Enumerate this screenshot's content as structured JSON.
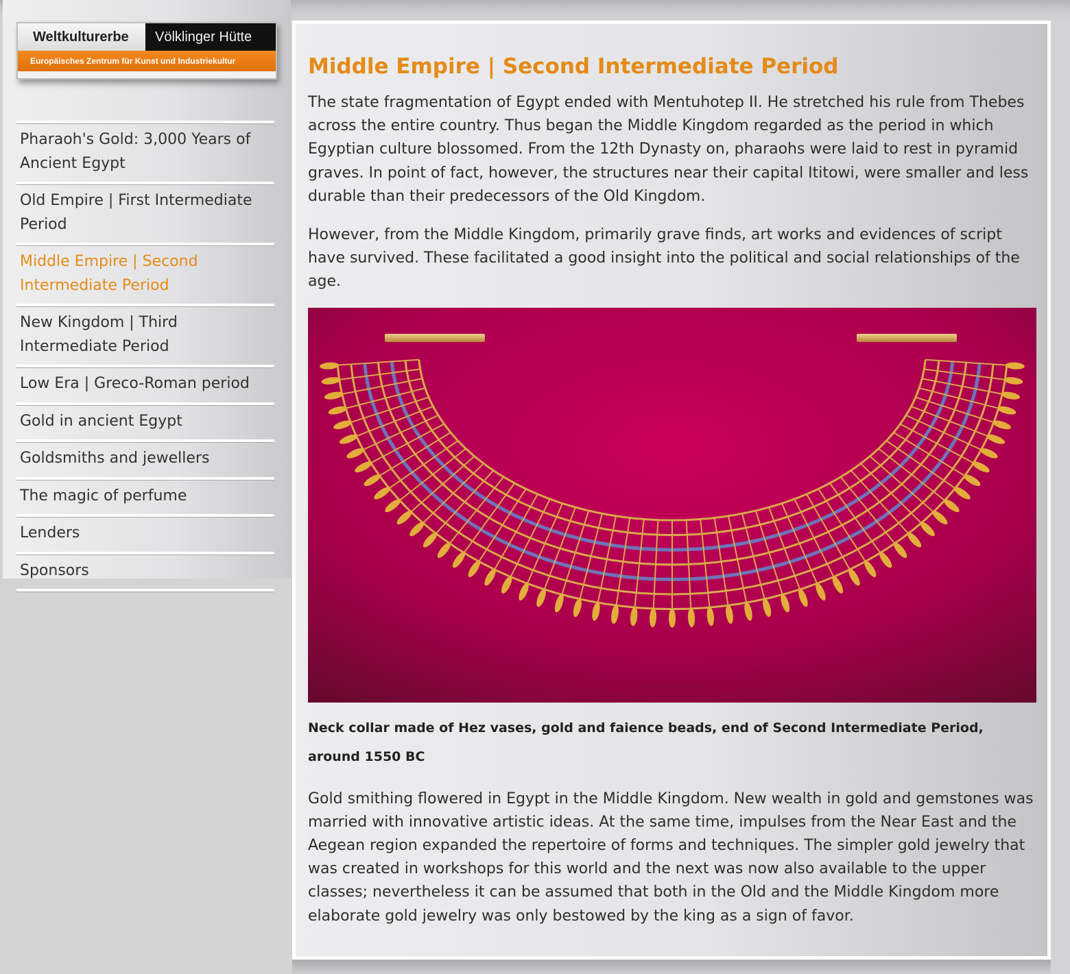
{
  "logo": {
    "left_text": "Weltkulturerbe",
    "right_text": "Völklinger Hütte",
    "subtitle": "Europäisches Zentrum für Kunst und Industriekultur"
  },
  "nav": {
    "items": [
      {
        "label": "Pharaoh's Gold: 3,000 Years of Ancient Egypt",
        "active": false
      },
      {
        "label": "Old Empire | First Intermediate Period",
        "active": false
      },
      {
        "label": "Middle Empire | Second Intermediate Period",
        "active": true
      },
      {
        "label": "New Kingdom | Third Intermediate Period",
        "active": false
      },
      {
        "label": "Low Era | Greco-Roman period",
        "active": false
      },
      {
        "label": "Gold in ancient Egypt",
        "active": false
      },
      {
        "label": "Goldsmiths and jewellers",
        "active": false
      },
      {
        "label": "The magic of perfume",
        "active": false
      },
      {
        "label": "Lenders",
        "active": false
      },
      {
        "label": "Sponsors",
        "active": false
      }
    ]
  },
  "colors": {
    "accent": "#e48b17",
    "figure_bg": "#b8004f",
    "gold": "#d9a84a",
    "faience": "#6f74b8"
  },
  "main": {
    "title": "Middle Empire | Second Intermediate Period",
    "paragraph_1": "The state fragmentation of Egypt ended with Mentuhotep II. He stretched his rule from Thebes across the entire country. Thus began the Middle Kingdom regarded as the period in which Egyptian culture blossomed. From the 12th Dynasty on, pharaohs were laid to rest in pyramid graves. In point of fact, however, the structures near their capital Ititowi, were smaller and less durable than their predecessors of the Old Kingdom.",
    "paragraph_2": "However, from the Middle Kingdom, primarily grave finds, art works and evidences of script have survived. These facilitated a good insight into the political and social relationships of the age.",
    "caption": "Neck collar made of Hez vases, gold and faience beads, end of Second Intermediate Period, around 1550 BC",
    "paragraph_3": "Gold smithing flowered in Egypt in the Middle Kingdom. New wealth in gold and gemstones was married with innovative artistic ideas. At the same time, impulses  from the Near East and the Aegean region expanded the repertoire of forms and techniques. The simpler gold jewelry that was created in workshops for this world and the next was now also available to the upper classes; nevertheless it can be assumed that both in the Old and the Middle Kingdom more elaborate gold jewelry was only bestowed by the king as a sign of favor."
  }
}
